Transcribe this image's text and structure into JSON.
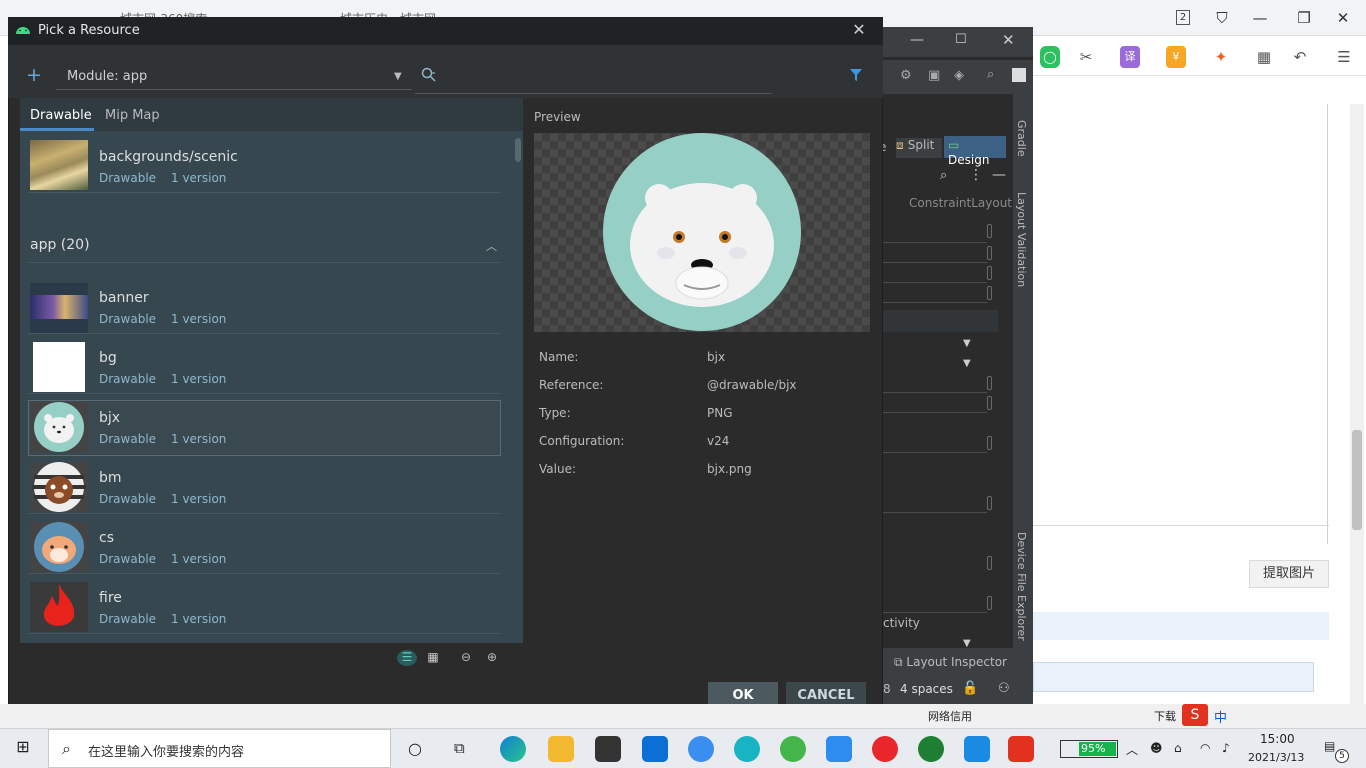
{
  "browser": {
    "tab1_label": "城市网-360搜索",
    "tab2_label": "城市历史 - 城市网",
    "tab_count": "2",
    "extract_button": "提取图片",
    "strip": {
      "text1": "网络信用",
      "text2": "下载",
      "text3": "中"
    }
  },
  "ide": {
    "split_label": "Split",
    "design_label": "Design",
    "layout_label": "ConstraintLayout",
    "activity_label": "ctivity",
    "layout_inspector": "Layout Inspector",
    "indent": "4 spaces",
    "indent_num": "8",
    "side_gradle": "Gradle",
    "side_validation": "Layout Validation",
    "side_device": "Device File Explorer"
  },
  "dialog": {
    "title": "Pick a Resource",
    "module_label": "Module: app",
    "search_placeholder": "",
    "tabs": [
      {
        "label": "Drawable",
        "active": true
      },
      {
        "label": "Mip Map",
        "active": false
      }
    ],
    "top_item": {
      "name": "backgrounds/scenic",
      "type": "Drawable",
      "versions": "1 version"
    },
    "group": {
      "name": "app (20)"
    },
    "items": [
      {
        "name": "banner",
        "type": "Drawable",
        "versions": "1 version"
      },
      {
        "name": "bg",
        "type": "Drawable",
        "versions": "1 version"
      },
      {
        "name": "bjx",
        "type": "Drawable",
        "versions": "1 version",
        "selected": true
      },
      {
        "name": "bm",
        "type": "Drawable",
        "versions": "1 version"
      },
      {
        "name": "cs",
        "type": "Drawable",
        "versions": "1 version"
      },
      {
        "name": "fire",
        "type": "Drawable",
        "versions": "1 version"
      }
    ],
    "preview": {
      "label": "Preview",
      "properties": [
        {
          "key": "Name:",
          "value": "bjx"
        },
        {
          "key": "Reference:",
          "value": "@drawable/bjx"
        },
        {
          "key": "Type:",
          "value": "PNG"
        },
        {
          "key": "Configuration:",
          "value": "v24"
        },
        {
          "key": "Value:",
          "value": "bjx.png"
        }
      ]
    },
    "ok_label": "OK",
    "cancel_label": "CANCEL"
  },
  "taskbar": {
    "search_placeholder": "在这里输入你要搜索的内容",
    "battery": "95%",
    "time": "15:00",
    "date": "2021/3/13",
    "notif_count": "5"
  },
  "colors": {
    "accent": "#4a88c7",
    "panel": "#36474f",
    "dialog_bg": "#2b2b2b",
    "preview_circle": "#96cfc6"
  }
}
